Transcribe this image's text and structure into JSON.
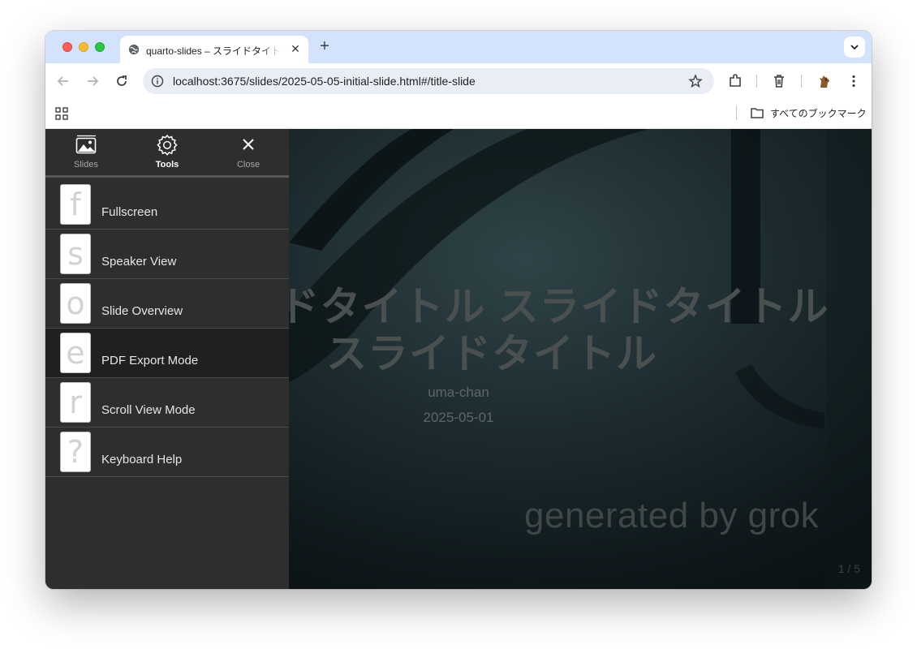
{
  "browser": {
    "tab": {
      "title": "quarto-slides – スライドタイトル スライドタイトル スライドタイトル"
    },
    "url": "localhost:3675/slides/2025-05-05-initial-slide.html#/title-slide",
    "bookmarks": {
      "all_label": "すべてのブックマーク"
    }
  },
  "menu": {
    "tabs": [
      {
        "label": "Slides",
        "icon": "image-icon"
      },
      {
        "label": "Tools",
        "icon": "gear-icon",
        "active": true
      },
      {
        "label": "Close",
        "icon": "close-icon"
      }
    ],
    "items": [
      {
        "key": "f",
        "label": "Fullscreen"
      },
      {
        "key": "s",
        "label": "Speaker View"
      },
      {
        "key": "o",
        "label": "Slide Overview"
      },
      {
        "key": "e",
        "label": "PDF Export Mode",
        "highlighted": true
      },
      {
        "key": "r",
        "label": "Scroll View Mode"
      },
      {
        "key": "?",
        "label": "Keyboard Help"
      }
    ]
  },
  "slide": {
    "title": "スライドタイトル スライドタイトル スライドタイトル",
    "author": "uma-chan",
    "date": "2025-05-01",
    "watermark": "generated by grok",
    "number": "1 / 5"
  },
  "colors": {
    "tabstrip": "#d3e3fd",
    "menu_bg": "#2e2e2e",
    "menu_highlight": "#202020",
    "slide_text": "#4a4f50"
  }
}
